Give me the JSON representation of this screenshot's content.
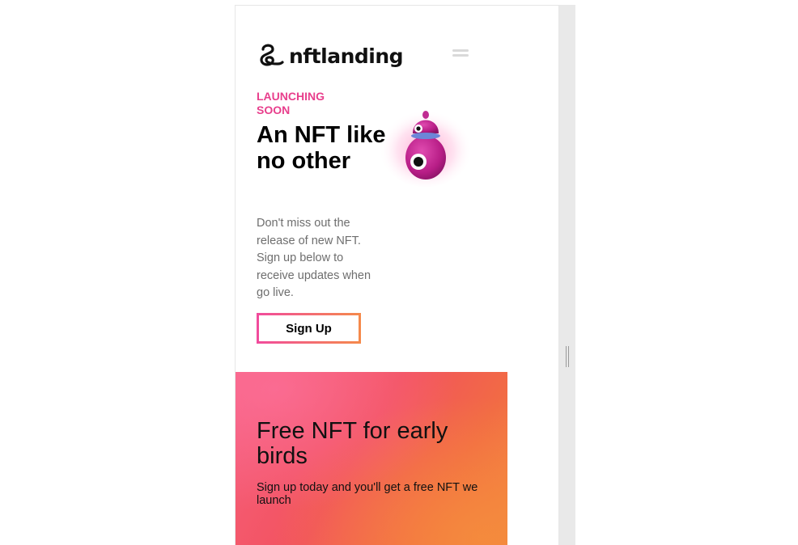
{
  "brand": {
    "name": "nftlanding",
    "logo_icon": "swirl-logo-icon"
  },
  "header": {
    "menu_icon": "hamburger-menu-icon"
  },
  "hero": {
    "eyebrow": "LAUNCHING SOON",
    "title": "An NFT like no other",
    "description": "Don't miss out the release of new NFT. Sign up below to receive updates when go live.",
    "cta_label": "Sign Up",
    "image_icon": "pink-monster-character"
  },
  "promo": {
    "title": "Free NFT for early birds",
    "text": "Sign up today and you'll get a free NFT we launch"
  },
  "colors": {
    "accent": "#e83e8c",
    "gradient_start": "#f6607e",
    "gradient_end": "#f38640"
  }
}
